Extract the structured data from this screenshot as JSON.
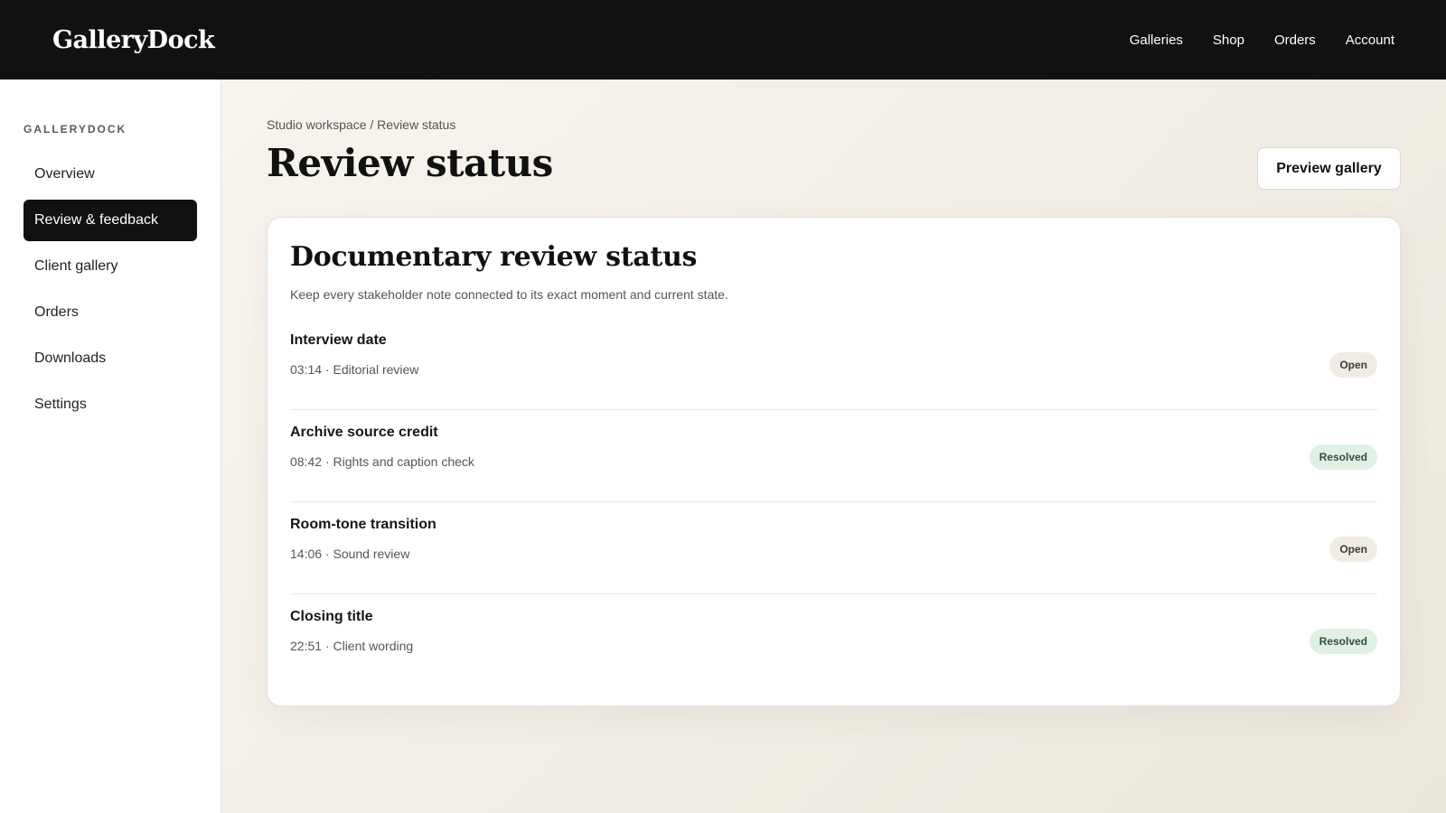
{
  "header": {
    "brand": "GalleryDock",
    "nav": [
      "Galleries",
      "Shop",
      "Orders",
      "Account"
    ]
  },
  "sidebar": {
    "section_label": "GALLERYDOCK",
    "items": [
      {
        "label": "Overview",
        "active": false
      },
      {
        "label": "Review & feedback",
        "active": true
      },
      {
        "label": "Client gallery",
        "active": false
      },
      {
        "label": "Orders",
        "active": false
      },
      {
        "label": "Downloads",
        "active": false
      },
      {
        "label": "Settings",
        "active": false
      }
    ]
  },
  "main": {
    "breadcrumb": "Studio workspace / Review status",
    "title": "Review status",
    "preview_button": "Preview gallery",
    "card": {
      "title": "Documentary review status",
      "subtitle": "Keep every stakeholder note connected to its exact moment and current state.",
      "rows": [
        {
          "title": "Interview date",
          "meta": "03:14 · Editorial review",
          "status": "Open"
        },
        {
          "title": "Archive source credit",
          "meta": "08:42 · Rights and caption check",
          "status": "Resolved"
        },
        {
          "title": "Room-tone transition",
          "meta": "14:06 · Sound review",
          "status": "Open"
        },
        {
          "title": "Closing title",
          "meta": "22:51 · Client wording",
          "status": "Resolved"
        }
      ]
    }
  },
  "colors": {
    "topbar": "#111111",
    "active_nav": "#111111",
    "badge_open": "#f0ece4",
    "badge_resolved": "#dff0e4",
    "page_bg": "#f3efe7"
  }
}
